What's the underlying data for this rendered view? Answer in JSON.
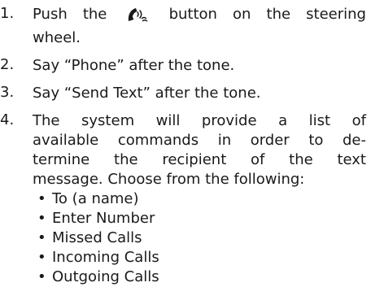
{
  "steps": [
    {
      "number": "1.",
      "line1_before_icon": "Push the",
      "icon": "phone-voice-icon",
      "line1_after_icon": "button on the steering",
      "line2": "wheel."
    },
    {
      "number": "2.",
      "text": "Say “Phone” after the tone."
    },
    {
      "number": "3.",
      "text": "Say “Send Text” after the tone."
    },
    {
      "number": "4.",
      "lines": [
        "The system will provide a list of",
        "available commands in order to de-",
        "termine the recipient of the text",
        "message. Choose from the following:"
      ],
      "options": [
        "To (a name)",
        "Enter Number",
        "Missed Calls",
        "Incoming Calls",
        "Outgoing Calls"
      ]
    }
  ]
}
